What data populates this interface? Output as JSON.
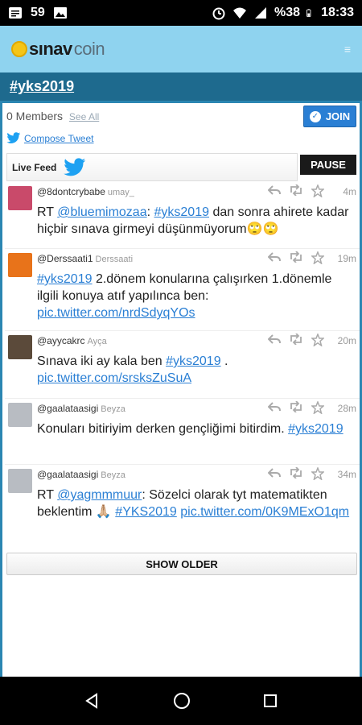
{
  "statusbar": {
    "notif_count": "59",
    "battery": "%38",
    "time": "18:33"
  },
  "appbar": {
    "logo_part1": "sınav",
    "logo_part2": "coin",
    "menu_glyph": "≡"
  },
  "tagbar": {
    "hashtag": "#yks2019"
  },
  "members": {
    "label": "0 Members",
    "see_all": "See All",
    "join": "JOIN"
  },
  "compose": {
    "label": "Compose Tweet"
  },
  "feed": {
    "label": "Live Feed",
    "pause": "PAUSE"
  },
  "tweets": [
    {
      "screen_name": "@8dontcrybabe",
      "real_name": "umay_",
      "time": "4m",
      "parts": [
        {
          "t": "RT "
        },
        {
          "l": "@bluemimozaa"
        },
        {
          "t": ": "
        },
        {
          "l": "#yks2019"
        },
        {
          "t": " dan sonra ahirete kadar hiçbir sınava girmeyi düşünmüyorum🙄🙄"
        }
      ]
    },
    {
      "screen_name": "@Derssaati1",
      "real_name": "Derssaati",
      "time": "19m",
      "parts": [
        {
          "l": "#yks2019"
        },
        {
          "t": " 2.dönem konularına çalışırken 1.dönemle ilgili konuya atıf yapılınca ben: "
        },
        {
          "l": "pic.twitter.com/nrdSdyqYOs"
        }
      ]
    },
    {
      "screen_name": "@ayycakrc",
      "real_name": "Ayça",
      "time": "20m",
      "parts": [
        {
          "t": "Sınava iki ay kala ben "
        },
        {
          "l": "#yks2019"
        },
        {
          "t": " . "
        },
        {
          "l": "pic.twitter.com/srsksZuSuA"
        }
      ]
    },
    {
      "screen_name": "@gaalataasigi",
      "real_name": "Beyza",
      "time": "28m",
      "parts": [
        {
          "t": "Konuları bitiriyim derken gençliğimi bitirdim. "
        },
        {
          "l": "#yks2019"
        }
      ]
    },
    {
      "screen_name": "@gaalataasigi",
      "real_name": "Beyza",
      "time": "34m",
      "parts": [
        {
          "t": "RT "
        },
        {
          "l": "@yagmmmuur"
        },
        {
          "t": ": Sözelci olarak tyt matematikten beklentim 🙏🏼 "
        },
        {
          "l": "#YKS2019"
        },
        {
          "t": " "
        },
        {
          "l": "pic.twitter.com/0K9MExO1qm"
        }
      ]
    }
  ],
  "show_older": "SHOW OLDER",
  "colors": {
    "appbar": "#8fd3ef",
    "tagbar": "#1e6a8e",
    "link": "#2a7fd4",
    "join": "#2a7fd4"
  }
}
